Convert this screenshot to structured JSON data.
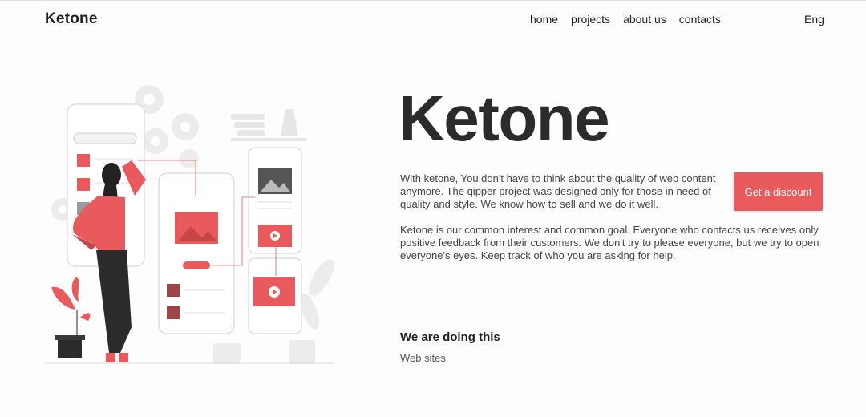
{
  "header": {
    "logo": "Ketone",
    "nav": [
      {
        "label": "home"
      },
      {
        "label": "projects"
      },
      {
        "label": "about us"
      },
      {
        "label": "contacts"
      }
    ],
    "language": "Eng"
  },
  "hero": {
    "title": "Ketone",
    "paragraph_1": "With ketone, You don't have to think about the quality of web content anymore. The qipper project was designed only for those in need of quality and style. We know how to sell and we do it well.",
    "paragraph_2": "Ketone is our common interest and common goal. Everyone who contacts us receives only positive feedback from their customers. We don't try to please everyone, but we try to open everyone's eyes. Keep track of who you are asking for help.",
    "cta_label": "Get a discount"
  },
  "services": {
    "heading": "We are doing this",
    "items": [
      "Web sites"
    ]
  },
  "colors": {
    "accent": "#e85a5b",
    "text": "#2b2b2b",
    "background": "#fdfdfd"
  }
}
